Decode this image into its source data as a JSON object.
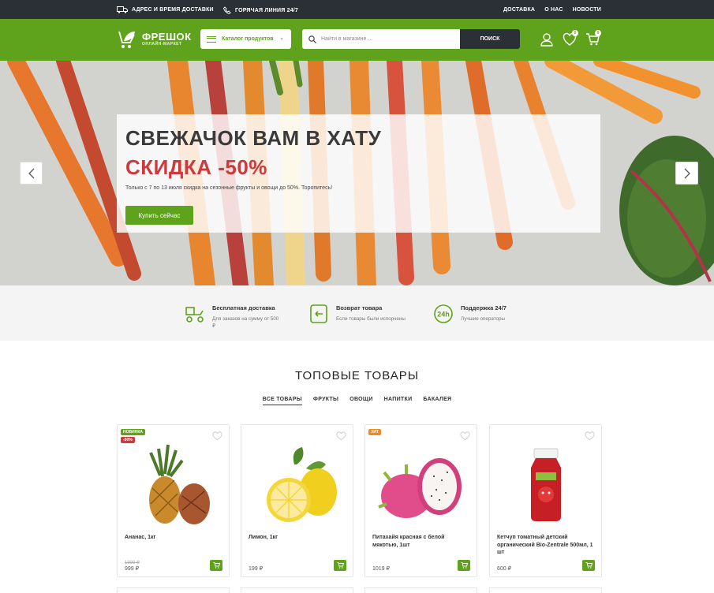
{
  "topbar": {
    "delivery_info": "АДРЕС И ВРЕМЯ ДОСТАВКИ",
    "hotline": "ГОРЯЧАЯ ЛИНИЯ 24/7",
    "nav": [
      "ДОСТАВКА",
      "О НАС",
      "НОВОСТИ"
    ]
  },
  "header": {
    "logo_name": "ФРЕШОК",
    "logo_sub": "ОНЛАЙН-МАРКЕТ",
    "catalog_label": "Каталог продуктов",
    "search_placeholder": "Найти в магазине ...",
    "search_button": "ПОИСК",
    "favorites_count": "0",
    "cart_count": "0"
  },
  "hero": {
    "title": "СВЕЖАЧОК ВАМ В ХАТУ",
    "subtitle": "СКИДКА -50%",
    "text": "Только с 7 по 13 июля скидка на сезонные фрукты и овощи до 50%. Торопитесь!",
    "button": "Купить сейчас"
  },
  "features": [
    {
      "title": "Бесплатная доставка",
      "desc": "Для заказов на сумму от 500 ₽",
      "icon": "delivery-scooter-icon"
    },
    {
      "title": "Возврат товара",
      "desc": "Если товары были испорчены",
      "icon": "return-box-icon"
    },
    {
      "title": "Поддержка 24/7",
      "desc": "Лучшие операторы",
      "icon": "support-24h-icon"
    }
  ],
  "products_section": {
    "title": "ТОПОВЫЕ ТОВАРЫ",
    "tabs": [
      "ВСЕ ТОВАРЫ",
      "ФРУКТЫ",
      "ОВОЩИ",
      "НАПИТКИ",
      "БАКАЛЕЯ"
    ],
    "active_tab": "ВСЕ ТОВАРЫ"
  },
  "products": [
    {
      "name": "Ананас, 1кг",
      "old_price": "1999 ₽",
      "price": "999 ₽",
      "tags": [
        "НОВИНКА",
        "-50%"
      ]
    },
    {
      "name": "Лимон, 1кг",
      "old_price": "",
      "price": "199 ₽",
      "tags": []
    },
    {
      "name": "Питахайя красная с белой мякотью, 1шт",
      "old_price": "",
      "price": "1019 ₽",
      "tags": [
        "ХИТ"
      ]
    },
    {
      "name": "Кетчуп томатный детский органический Bio-Zentrale 500мл, 1 шт",
      "old_price": "",
      "price": "600 ₽",
      "tags": []
    }
  ],
  "colors": {
    "brand_green": "#5fa21b",
    "dark": "#2b2f36",
    "accent_red": "#d0393b",
    "tag_new": "#5fa21b",
    "tag_sale": "#d0393b",
    "tag_hit": "#f08a1c"
  }
}
